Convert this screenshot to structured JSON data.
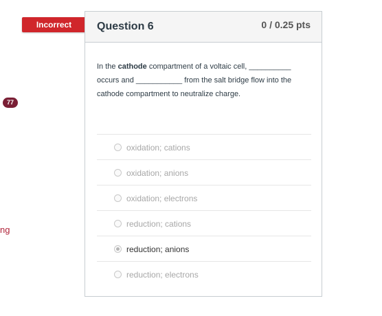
{
  "sidebar": {
    "badge_count": "77",
    "partial_text": "ng"
  },
  "status_ribbon": {
    "label": "Incorrect"
  },
  "question": {
    "title": "Question 6",
    "points": "0 / 0.25 pts",
    "text_before": "In the ",
    "text_bold": "cathode",
    "text_after": " compartment of a voltaic cell, __________ occurs and ___________ from the salt bridge flow into the cathode compartment to neutralize charge."
  },
  "answers": [
    {
      "label": "oxidation; cations",
      "selected": false
    },
    {
      "label": "oxidation; anions",
      "selected": false
    },
    {
      "label": "oxidation; electrons",
      "selected": false
    },
    {
      "label": "reduction; cations",
      "selected": false
    },
    {
      "label": "reduction; anions",
      "selected": true
    },
    {
      "label": "reduction; electrons",
      "selected": false
    }
  ]
}
